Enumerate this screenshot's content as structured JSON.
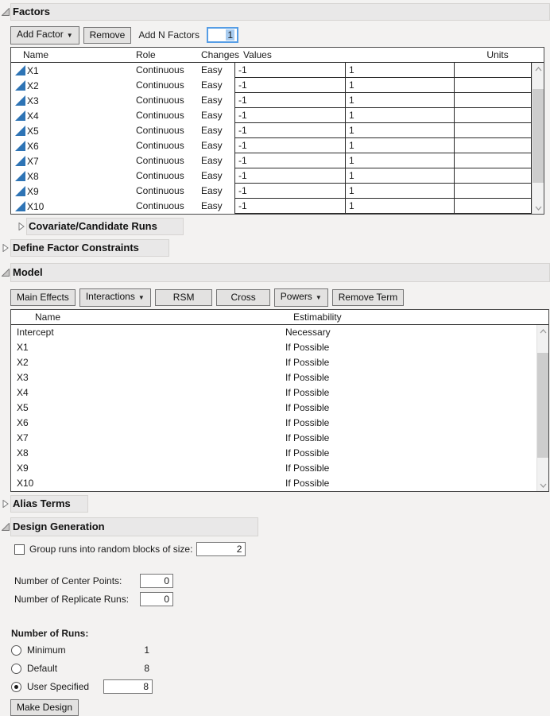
{
  "colors": {
    "accent_blue": "#2e74b5",
    "focus_border": "#569de5",
    "selection_bg": "#a8ccf0",
    "band_bg": "#e9e8e8",
    "button_bg": "#e3e2e1"
  },
  "factors": {
    "title": "Factors",
    "toolbar": {
      "add_factor": "Add Factor",
      "remove": "Remove",
      "add_n_label": "Add N Factors",
      "add_n_value": "1"
    },
    "table": {
      "headers": {
        "name": "Name",
        "role": "Role",
        "changes": "Changes",
        "values": "Values",
        "units": "Units"
      },
      "rows": [
        {
          "name": "X1",
          "role": "Continuous",
          "changes": "Easy",
          "low": "-1",
          "high": "1",
          "units": ""
        },
        {
          "name": "X2",
          "role": "Continuous",
          "changes": "Easy",
          "low": "-1",
          "high": "1",
          "units": ""
        },
        {
          "name": "X3",
          "role": "Continuous",
          "changes": "Easy",
          "low": "-1",
          "high": "1",
          "units": ""
        },
        {
          "name": "X4",
          "role": "Continuous",
          "changes": "Easy",
          "low": "-1",
          "high": "1",
          "units": ""
        },
        {
          "name": "X5",
          "role": "Continuous",
          "changes": "Easy",
          "low": "-1",
          "high": "1",
          "units": ""
        },
        {
          "name": "X6",
          "role": "Continuous",
          "changes": "Easy",
          "low": "-1",
          "high": "1",
          "units": ""
        },
        {
          "name": "X7",
          "role": "Continuous",
          "changes": "Easy",
          "low": "-1",
          "high": "1",
          "units": ""
        },
        {
          "name": "X8",
          "role": "Continuous",
          "changes": "Easy",
          "low": "-1",
          "high": "1",
          "units": ""
        },
        {
          "name": "X9",
          "role": "Continuous",
          "changes": "Easy",
          "low": "-1",
          "high": "1",
          "units": ""
        },
        {
          "name": "X10",
          "role": "Continuous",
          "changes": "Easy",
          "low": "-1",
          "high": "1",
          "units": ""
        }
      ]
    }
  },
  "covariate": {
    "title": "Covariate/Candidate Runs"
  },
  "constraints": {
    "title": "Define Factor Constraints"
  },
  "model": {
    "title": "Model",
    "toolbar": {
      "main_effects": "Main Effects",
      "interactions": "Interactions",
      "rsm": "RSM",
      "cross": "Cross",
      "powers": "Powers",
      "remove_term": "Remove Term"
    },
    "table": {
      "headers": {
        "name": "Name",
        "estimability": "Estimability"
      },
      "rows": [
        {
          "name": "Intercept",
          "estimability": "Necessary"
        },
        {
          "name": "X1",
          "estimability": "If Possible"
        },
        {
          "name": "X2",
          "estimability": "If Possible"
        },
        {
          "name": "X3",
          "estimability": "If Possible"
        },
        {
          "name": "X4",
          "estimability": "If Possible"
        },
        {
          "name": "X5",
          "estimability": "If Possible"
        },
        {
          "name": "X6",
          "estimability": "If Possible"
        },
        {
          "name": "X7",
          "estimability": "If Possible"
        },
        {
          "name": "X8",
          "estimability": "If Possible"
        },
        {
          "name": "X9",
          "estimability": "If Possible"
        },
        {
          "name": "X10",
          "estimability": "If Possible"
        }
      ]
    }
  },
  "alias": {
    "title": "Alias Terms"
  },
  "design_generation": {
    "title": "Design Generation",
    "block_checkbox_label": "Group runs into random blocks of size:",
    "block_size_value": "2",
    "center_points_label": "Number of Center Points:",
    "center_points_value": "0",
    "replicate_runs_label": "Number of Replicate Runs:",
    "replicate_runs_value": "0",
    "number_of_runs_label": "Number of Runs:",
    "run_options": [
      {
        "label": "Minimum",
        "value": "1",
        "selected": false
      },
      {
        "label": "Default",
        "value": "8",
        "selected": false
      },
      {
        "label": "User Specified",
        "value": "8",
        "selected": true
      }
    ],
    "make_design_label": "Make Design"
  }
}
